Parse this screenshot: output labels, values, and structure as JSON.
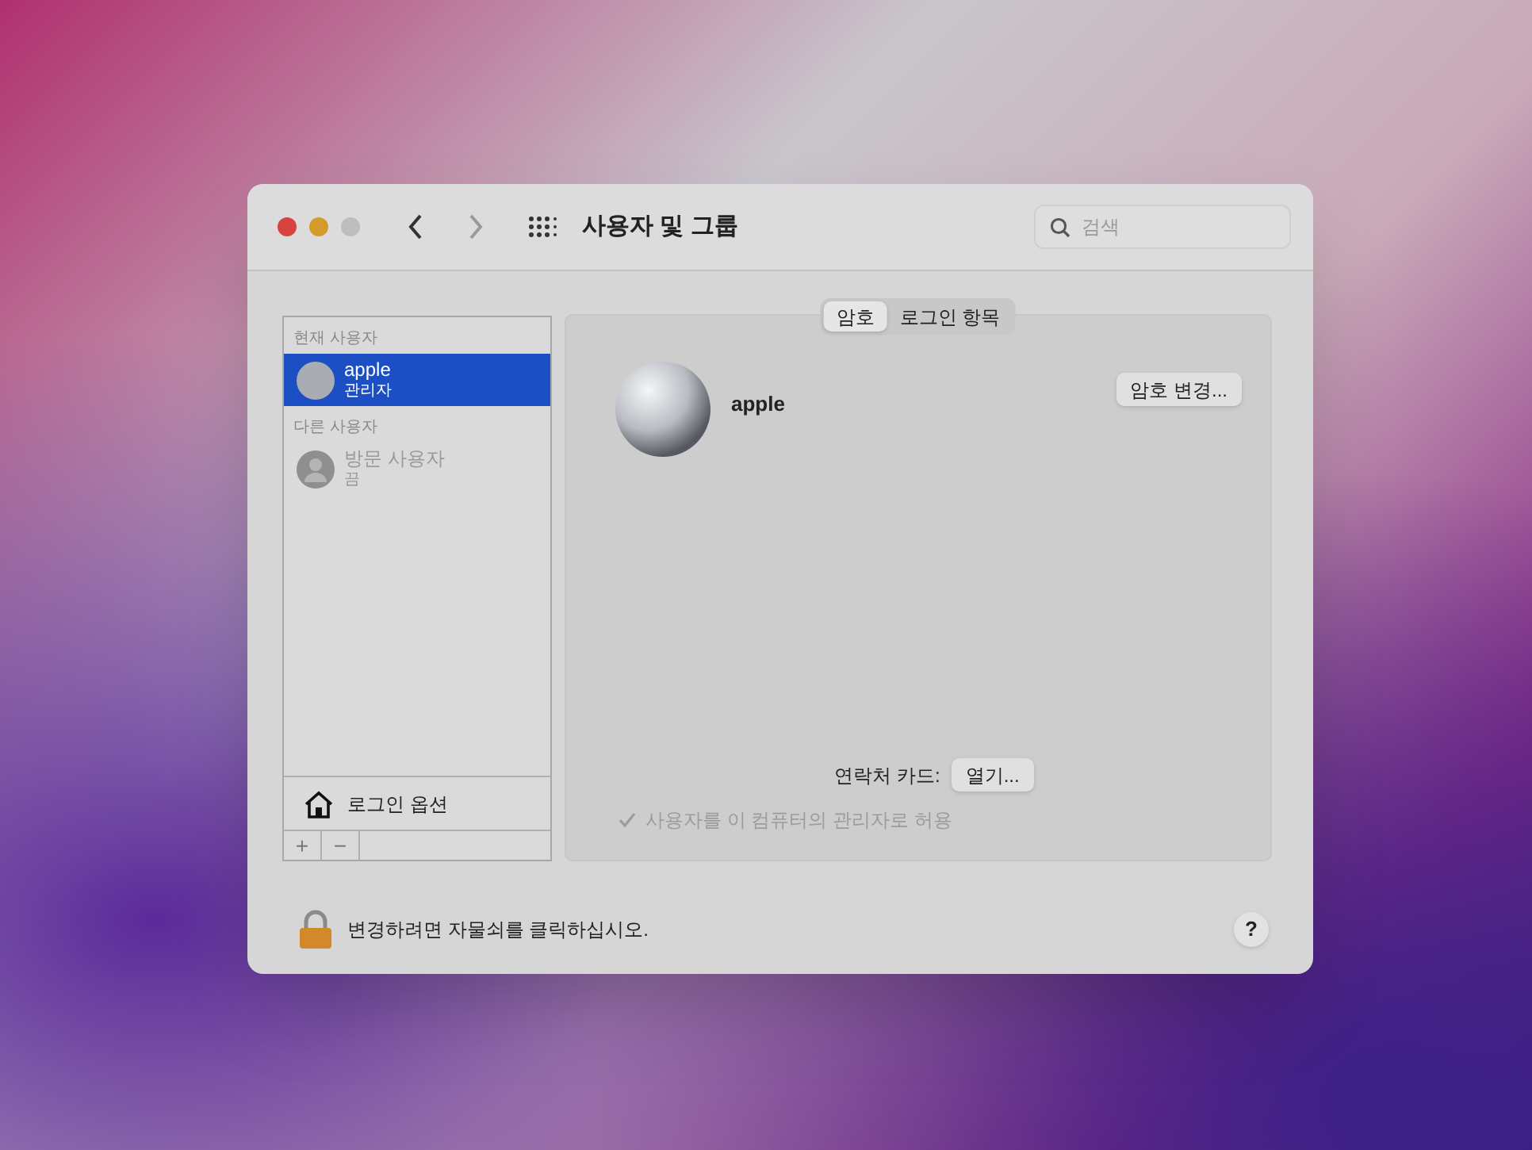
{
  "window": {
    "title": "사용자 및 그룹",
    "back_enabled": true,
    "forward_enabled": false,
    "search": {
      "placeholder": "검색"
    }
  },
  "sidebar": {
    "sections": [
      {
        "header": "현재 사용자",
        "users": [
          {
            "name": "apple",
            "role": "관리자",
            "selected": true,
            "disabled": false,
            "kind": "ball"
          }
        ]
      },
      {
        "header": "다른 사용자",
        "users": [
          {
            "name": "방문 사용자",
            "role": "끔",
            "selected": false,
            "disabled": true,
            "kind": "generic"
          }
        ]
      }
    ],
    "login_options": "로그인 옵션",
    "add_button": "+",
    "remove_button": "−"
  },
  "tabs": [
    {
      "label": "암호",
      "selected": true
    },
    {
      "label": "로그인 항목",
      "selected": false
    }
  ],
  "user": {
    "name": "apple",
    "change_password_button": "암호 변경..."
  },
  "contact_card": {
    "label": "연락처 카드:",
    "button": "열기..."
  },
  "admin_checkbox": {
    "label": "사용자를 이 컴퓨터의 관리자로 허용",
    "checked": true,
    "disabled": true
  },
  "footer": {
    "lock_text": "변경하려면 자물쇠를 클릭하십시오.",
    "help_button": "?"
  }
}
